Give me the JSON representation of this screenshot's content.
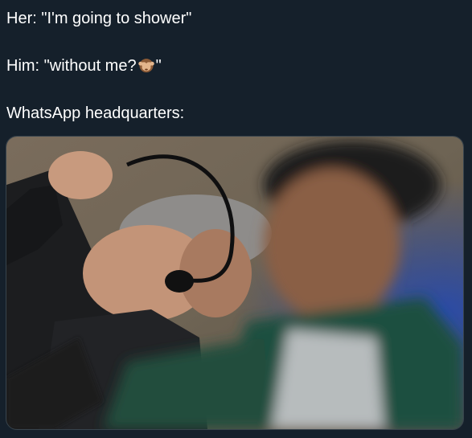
{
  "tweet": {
    "line1": "Her: \"I'm going to shower\"",
    "line2_prefix": "Him: \"without me?",
    "line2_suffix": "\"",
    "line3": "WhatsApp headquarters:"
  },
  "icons": {
    "emoji": "see-no-evil-monkey-icon"
  },
  "colors": {
    "background": "#15202b",
    "text": "#ffffff",
    "media_border": "#38444d"
  }
}
